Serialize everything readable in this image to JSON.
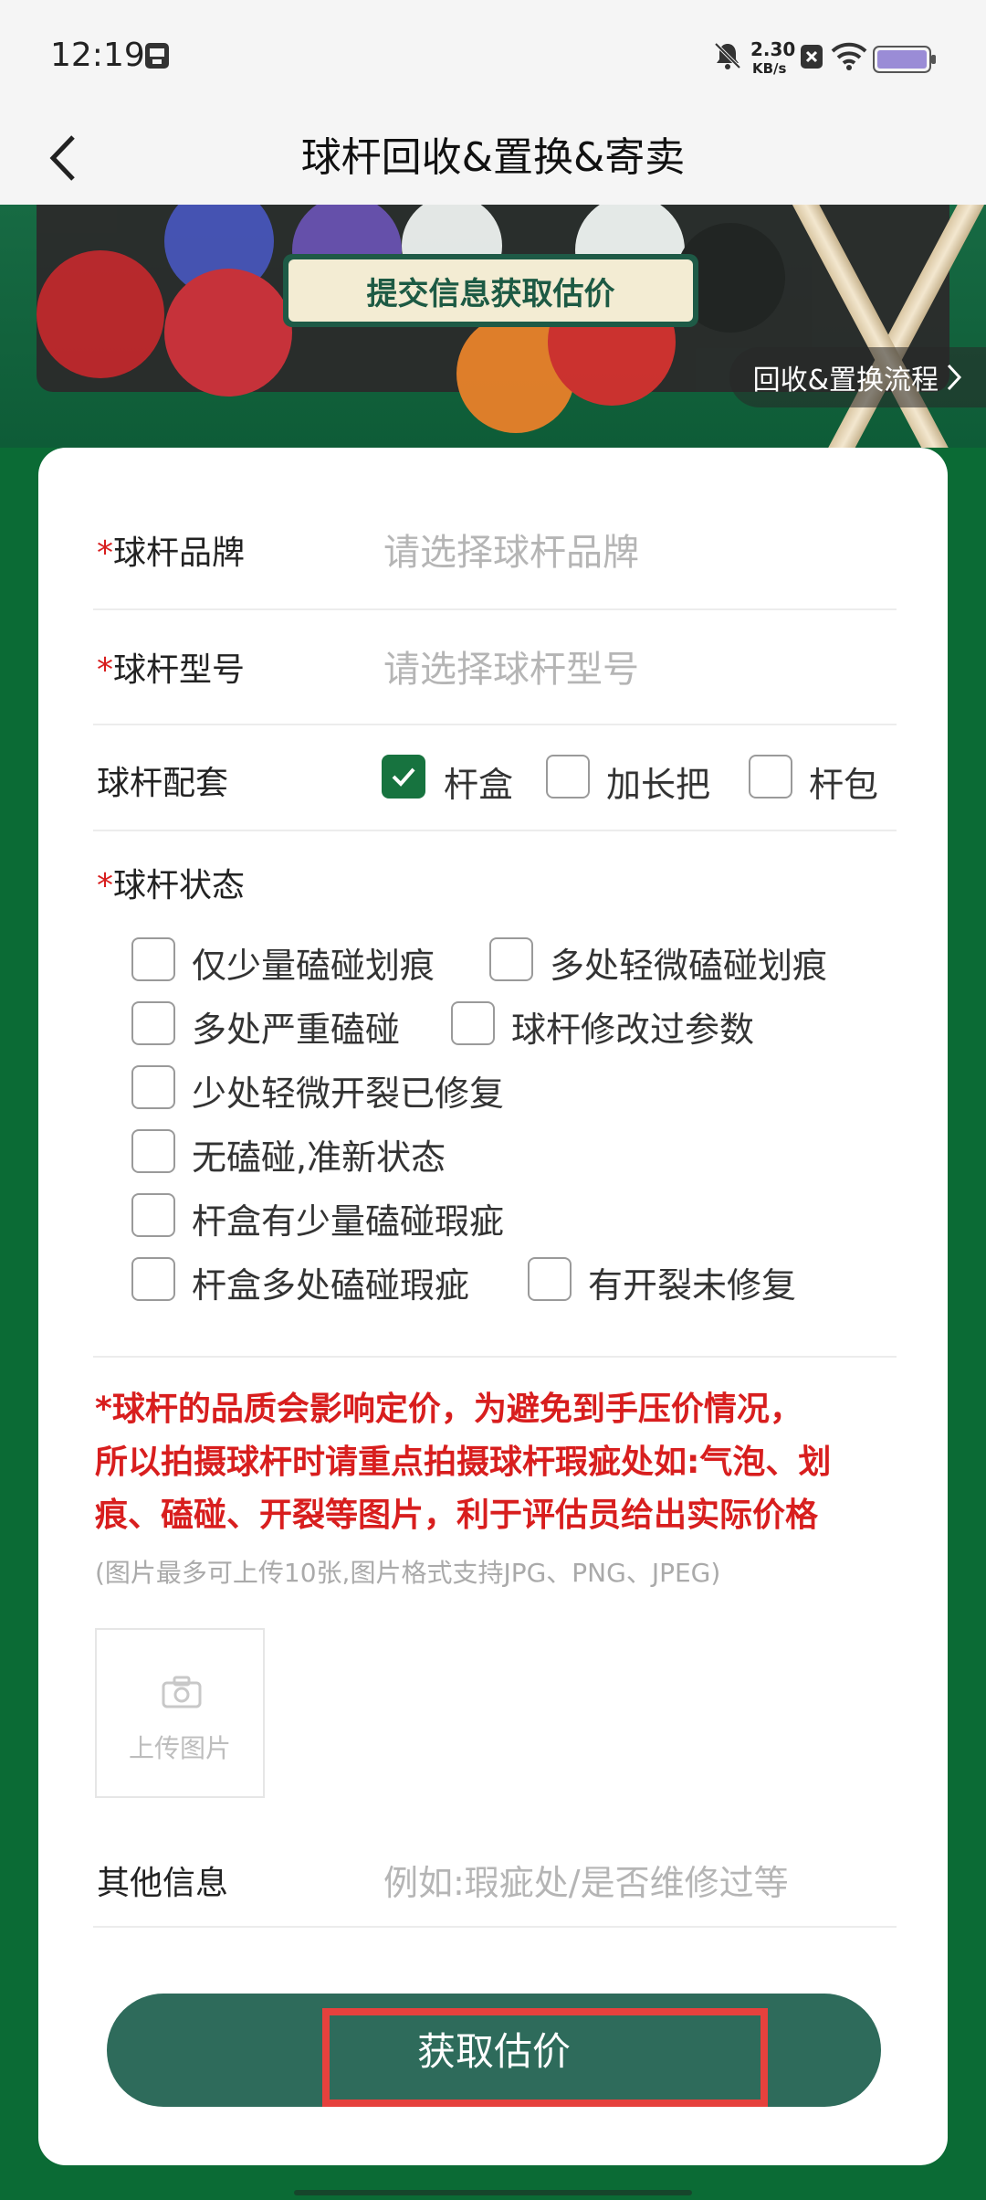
{
  "status": {
    "time": "12:19",
    "net_speed_value": "2.30",
    "net_speed_unit": "KB/s",
    "icons": [
      "sim-card-icon",
      "bell-off-icon",
      "close-box-icon",
      "wifi-icon",
      "battery-icon"
    ]
  },
  "header": {
    "title": "球杆回收&置换&寄卖",
    "back_icon": "chevron-left-icon"
  },
  "banner": {
    "badge": "提交信息获取估价",
    "process_link": "回收&置换流程"
  },
  "form": {
    "brand": {
      "label": "球杆品牌",
      "required": "*",
      "placeholder": "请选择球杆品牌"
    },
    "model": {
      "label": "球杆型号",
      "required": "*",
      "placeholder": "请选择球杆型号"
    },
    "accessories": {
      "label": "球杆配套",
      "options": [
        {
          "label": "杆盒",
          "checked": true
        },
        {
          "label": "加长把",
          "checked": false
        },
        {
          "label": "杆包",
          "checked": false
        }
      ]
    },
    "condition": {
      "label": "球杆状态",
      "required": "*",
      "options": [
        "仅少量磕碰划痕",
        "多处轻微磕碰划痕",
        "多处严重磕碰",
        "球杆修改过参数",
        "少处轻微开裂已修复",
        "无磕碰,准新状态",
        "杆盒有少量磕碰瑕疵",
        "杆盒多处磕碰瑕疵",
        "有开裂未修复"
      ]
    },
    "warning": {
      "line1": "*球杆的品质会影响定价，为避免到手压价情况，",
      "line2": "所以拍摄球杆时请重点拍摄球杆瑕疵处如:气泡、划",
      "line3": "痕、磕碰、开裂等图片，利于评估员给出实际价格"
    },
    "upload_hint": "(图片最多可上传10张,图片格式支持JPG、PNG、JPEG)",
    "upload_label": "上传图片",
    "other": {
      "label": "其他信息",
      "placeholder": "例如:瑕疵处/是否维修过等"
    },
    "submit": "获取估价"
  },
  "colors": {
    "accent": "#17733f",
    "button": "#2e6b5b",
    "required": "#d81e1e",
    "highlight": "#e6413d"
  }
}
